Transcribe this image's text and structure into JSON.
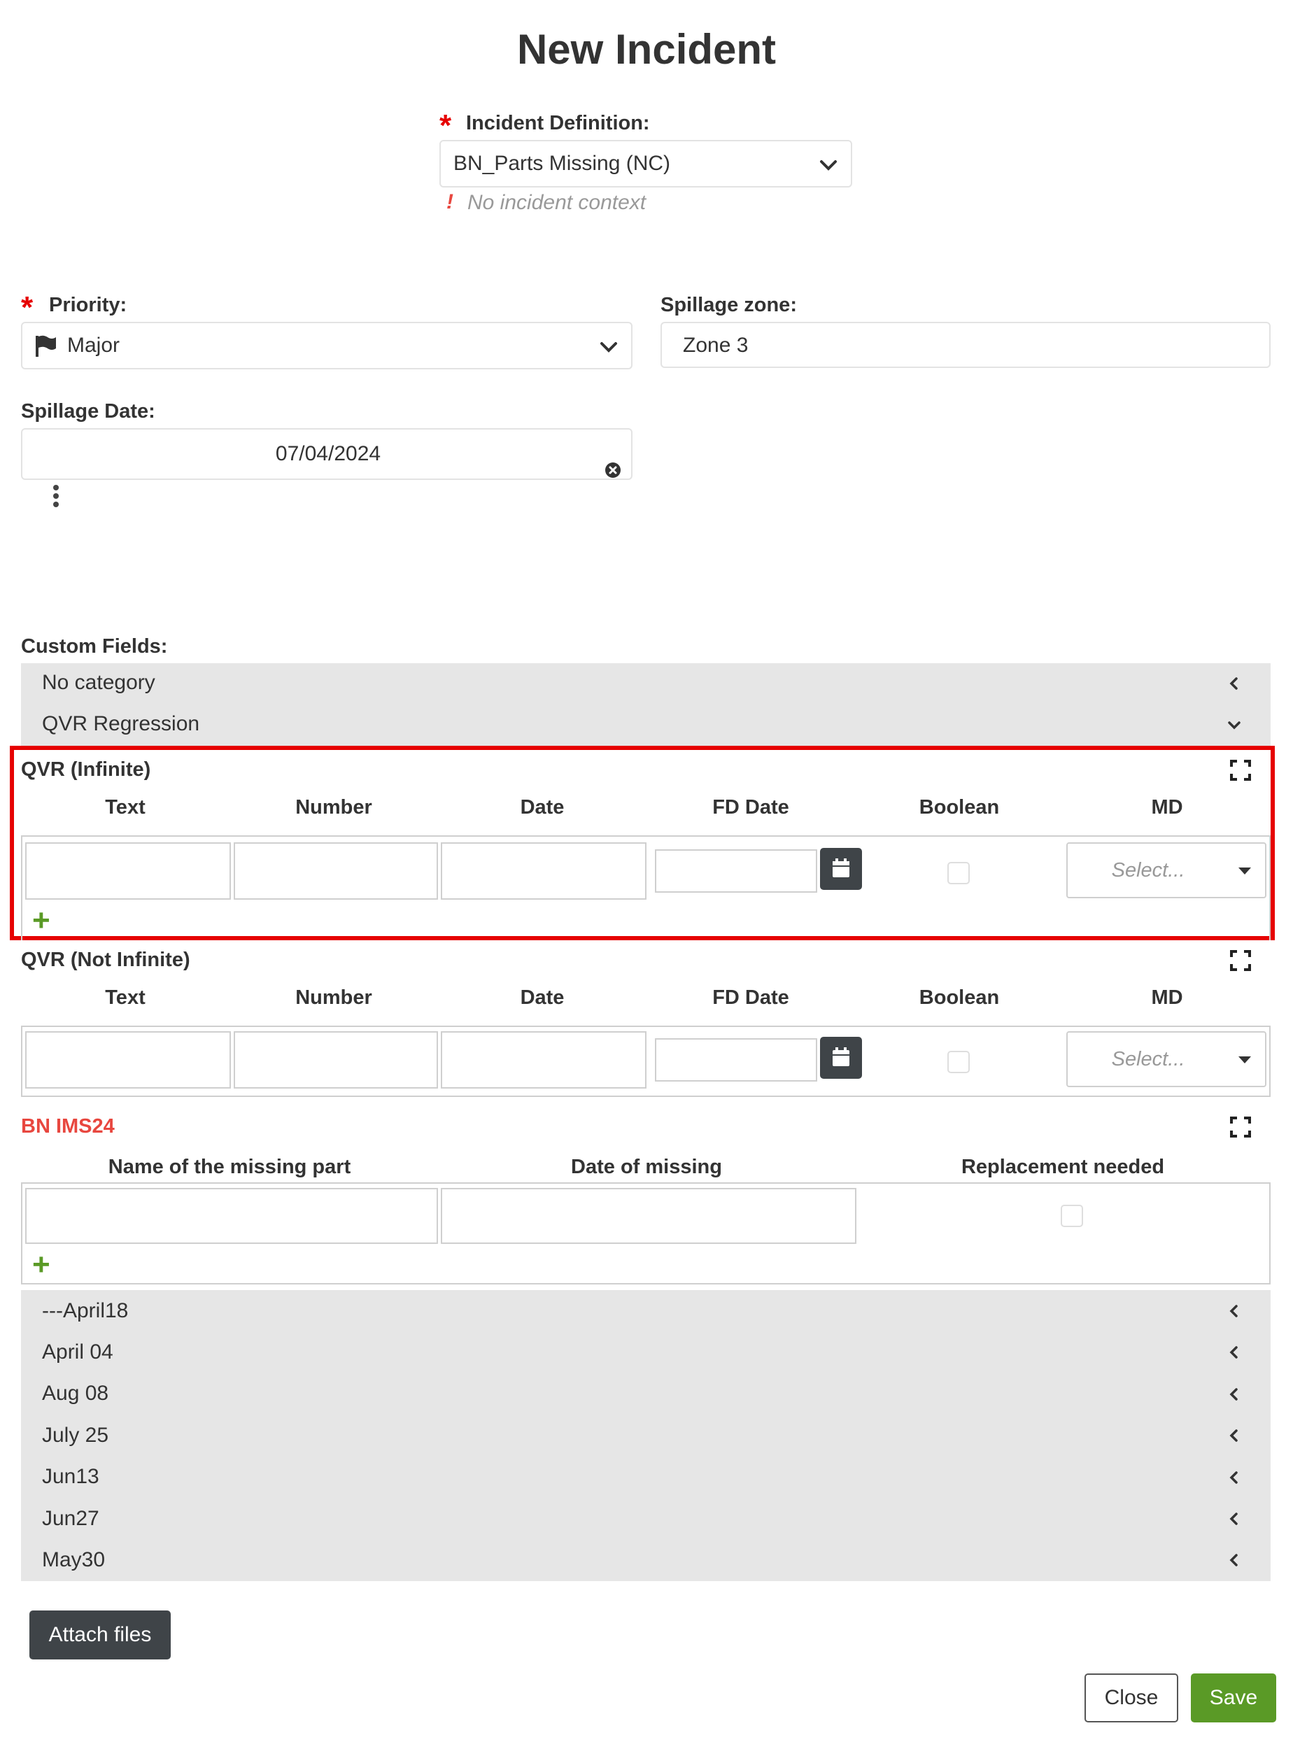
{
  "title": "New Incident",
  "incident_definition": {
    "label": "Incident Definition:",
    "value": "BN_Parts Missing (NC)",
    "warning_icon": "!",
    "warning": "No incident context"
  },
  "required_mark": "*",
  "priority": {
    "label": "Priority:",
    "value": "Major",
    "icon": "flag-icon"
  },
  "spillage_zone": {
    "label": "Spillage zone:",
    "value": "Zone 3"
  },
  "spillage_date": {
    "label": "Spillage Date:",
    "value": "07/04/2024"
  },
  "custom_fields": {
    "label": "Custom Fields:",
    "categories": [
      "No category",
      "QVR Regression"
    ]
  },
  "table_qvr_infinite": {
    "title": "QVR (Infinite)",
    "columns": [
      "Text",
      "Number",
      "Date",
      "FD Date",
      "Boolean",
      "MD"
    ],
    "select_placeholder": "Select...",
    "add_label": "+"
  },
  "table_qvr_not_infinite": {
    "title": "QVR (Not Infinite)",
    "columns": [
      "Text",
      "Number",
      "Date",
      "FD Date",
      "Boolean",
      "MD"
    ],
    "select_placeholder": "Select..."
  },
  "table_bn_ims24": {
    "title": "BN IMS24",
    "title_color": "#e8473f",
    "columns": [
      "Name of the missing part",
      "Date of missing",
      "Replacement needed"
    ],
    "add_label": "+"
  },
  "date_groups": [
    "---April18",
    "April 04",
    "Aug 08",
    "July 25",
    "Jun13",
    "Jun27",
    "May30"
  ],
  "buttons": {
    "attach": "Attach files",
    "close": "Close",
    "save": "Save"
  },
  "colors": {
    "accent_green": "#5a9a26",
    "required_red": "#e60000",
    "highlight_red": "#e60000",
    "dark_button": "#3f4448"
  }
}
